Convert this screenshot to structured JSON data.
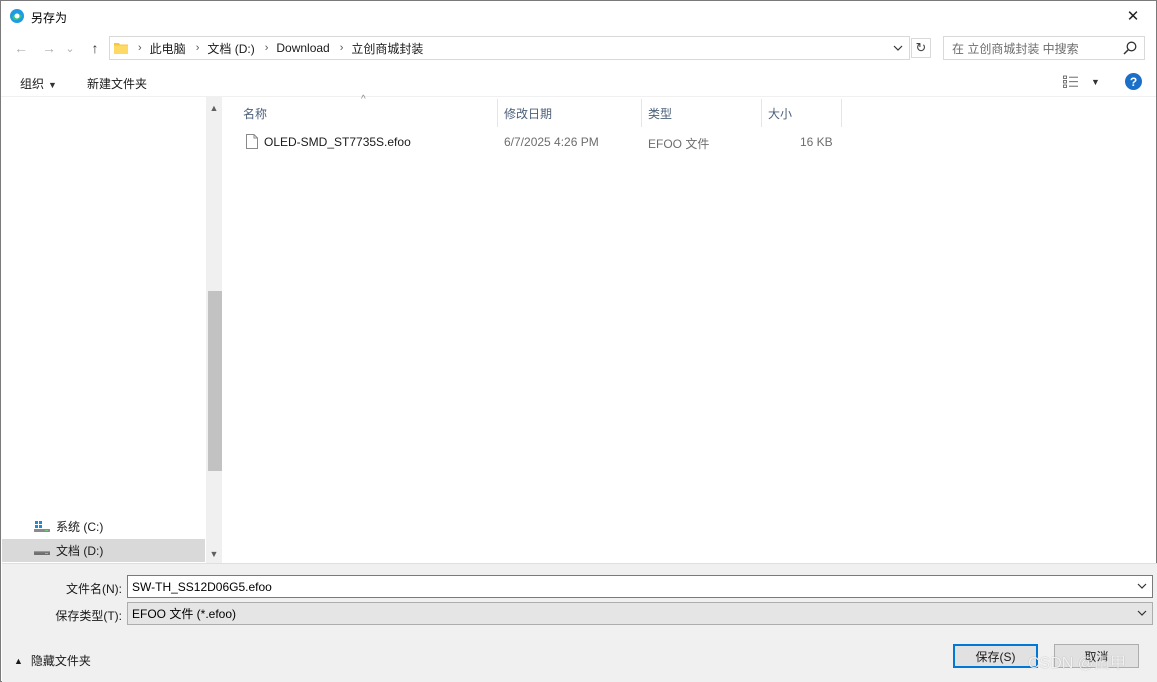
{
  "window": {
    "title": "另存为",
    "close_glyph": "✕"
  },
  "nav": {
    "back_glyph": "←",
    "forward_glyph": "→",
    "recent_glyph": "⌄",
    "up_glyph": "↑",
    "breadcrumbs": [
      "此电脑",
      "文档 (D:)",
      "Download",
      "立创商城封装"
    ],
    "refresh_glyph": "↻",
    "search_placeholder": "在 立创商城封装 中搜索"
  },
  "toolbar": {
    "organize_label": "组织",
    "new_folder_label": "新建文件夹",
    "help_label": "?"
  },
  "sidebar": {
    "items": [
      {
        "label": "系统 (C:)",
        "selected": false
      },
      {
        "label": "文档 (D:)",
        "selected": true
      }
    ]
  },
  "filelist": {
    "columns": {
      "name": "名称",
      "modified": "修改日期",
      "type": "类型",
      "size": "大小"
    },
    "rows": [
      {
        "name": "OLED-SMD_ST7735S.efoo",
        "modified": "6/7/2025 4:26 PM",
        "type": "EFOO 文件",
        "size": "16 KB"
      }
    ]
  },
  "form": {
    "filename_label": "文件名(N):",
    "filename_value": "SW-TH_SS12D06G5.efoo",
    "filetype_label": "保存类型(T):",
    "filetype_value": "EFOO 文件 (*.efoo)",
    "hide_folders_label": "隐藏文件夹",
    "save_label": "保存(S)",
    "cancel_label": "取消"
  },
  "watermark": "CSDN @田甲",
  "colors": {
    "accent": "#0078d7",
    "help": "#1a6fc9",
    "header_text": "#4c607a"
  }
}
